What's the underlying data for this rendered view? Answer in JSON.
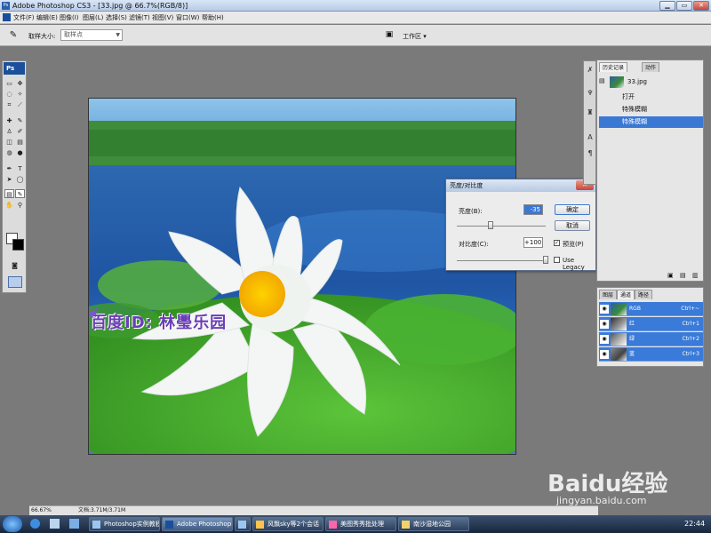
{
  "window": {
    "title": "Adobe Photoshop CS3 - [33.jpg @ 66.7%(RGB/8)]",
    "min": "▁",
    "max": "▭",
    "close": "✕"
  },
  "menus": [
    "文件(F)",
    "编辑(E)",
    "图像(I)",
    "图层(L)",
    "选择(S)",
    "滤镜(T)",
    "视图(V)",
    "窗口(W)",
    "帮助(H)"
  ],
  "options": {
    "sample_size_label": "取样大小:",
    "sample_size_value": "取样点",
    "workspace": "工作区 ▾"
  },
  "toolbox": {
    "logo": "Ps"
  },
  "canvas": {
    "watermark": "百度ID: 林璺乐园"
  },
  "dialog": {
    "title": "亮度/对比度",
    "brightness_label": "亮度(B):",
    "brightness_value": "-35",
    "contrast_label": "对比度(C):",
    "contrast_value": "+100",
    "ok": "确定",
    "cancel": "取消",
    "preview": "预览(P)",
    "use_legacy": "Use Legacy",
    "preview_checked": true,
    "legacy_checked": false,
    "brightness_level": -35,
    "contrast_level": 100
  },
  "history_panel": {
    "tabs": [
      "历史记录",
      "动作"
    ],
    "snapshot": "33.jpg",
    "items": [
      "打开",
      "特殊模糊",
      "特殊模糊"
    ],
    "selected_index": 2
  },
  "channels_panel": {
    "tabs": [
      "图层",
      "通道",
      "路径"
    ],
    "channels": [
      {
        "name": "RGB",
        "shortcut": "Ctrl+~"
      },
      {
        "name": "红",
        "shortcut": "Ctrl+1"
      },
      {
        "name": "绿",
        "shortcut": "Ctrl+2"
      },
      {
        "name": "蓝",
        "shortcut": "Ctrl+3"
      }
    ]
  },
  "status": {
    "zoom": "66.67%",
    "doc": "文档:3.71M/3.71M"
  },
  "taskbar": {
    "items": [
      "Photoshop实例教程...",
      "Adobe Photoshop ...",
      "",
      "风飘sky等2个会话",
      "美图秀秀批处理",
      "南沙湿地公园"
    ],
    "clock": "22:44"
  },
  "watermark": {
    "logo": "Baidu经验",
    "url": "jingyan.baidu.com"
  },
  "colors": {
    "accent": "#3a78d4",
    "titlebar": "#c8d8ef",
    "taskbar": "#243552"
  }
}
